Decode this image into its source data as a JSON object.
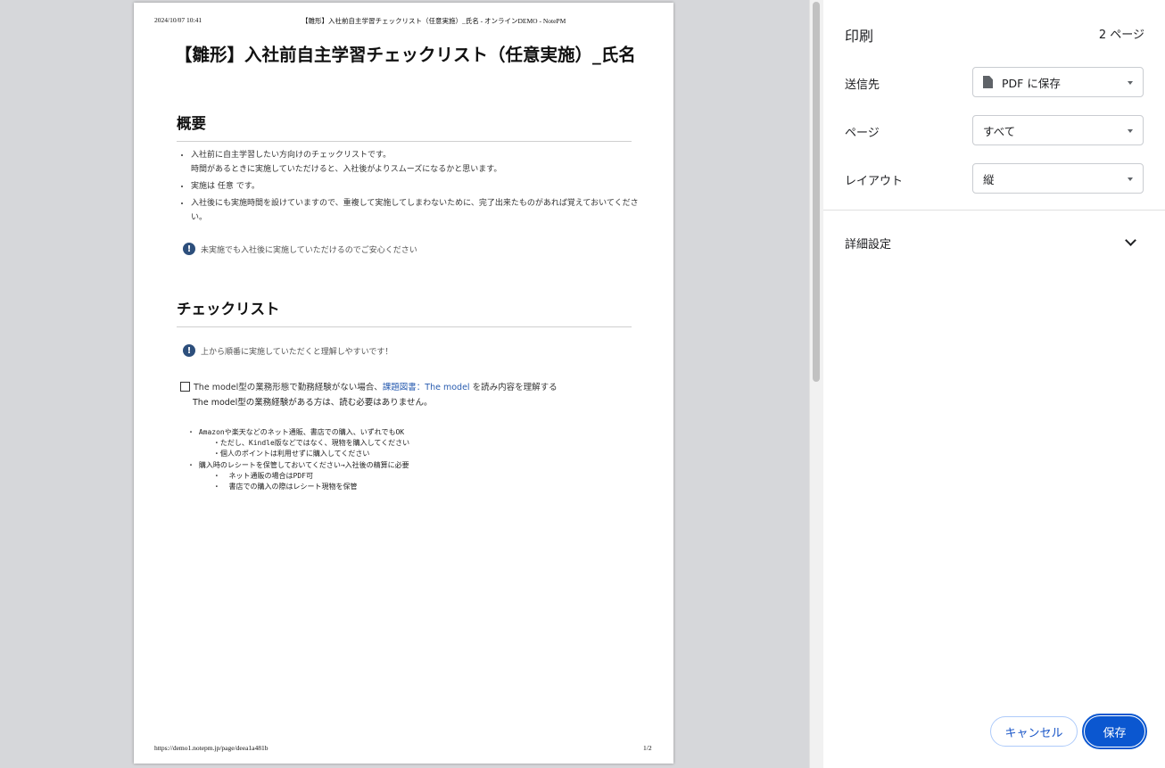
{
  "preview": {
    "header_date": "2024/10/07 10:41",
    "header_title": "【雛形】入社前自主学習チェックリスト（任意実施）_氏名 - オンラインDEMO - NotePM",
    "footer_url": "https://demo1.notepm.jp/page/deea1a481b",
    "footer_page": "1/2",
    "doc_title": "【雛形】入社前自主学習チェックリスト（任意実施）_氏名",
    "section1_heading": "概要",
    "bullets": [
      "入社前に自主学習したい方向けのチェックリストです。",
      "時間があるときに実施していただけると、入社後がよりスムーズになるかと思います。",
      "実施は 任意 です。",
      "入社後にも実施時間を設けていますので、重複して実施してしまわないために、完了出来たものがあれば覚えておいてください。"
    ],
    "note1": "未実施でも入社後に実施していただけるのでご安心ください",
    "section2_heading": "チェックリスト",
    "note2": "上から順番に実施していただくと理解しやすいです！",
    "check_item_prefix": "The model型の業務形態で勤務経験がない場合、",
    "check_item_link": "課題図書：The model",
    "check_item_suffix": " を読み内容を理解する",
    "check_item_sub": "The model型の業務経験がある方は、読む必要はありません。",
    "mono_lines": [
      "・ Amazonや楽天などのネット通販、書店での購入、いずれでもOK",
      "      ・ただし、Kindle版などではなく、現物を購入してください",
      "      ・個人のポイントは利用せずに購入してください",
      "・ 購入時のレシートを保管しておいてください→入社後の精算に必要",
      "      ・  ネット通販の場合はPDF可",
      "      ・  書店での購入の際はレシート現物を保管"
    ]
  },
  "panel": {
    "title": "印刷",
    "page_count": "2 ページ",
    "destination_label": "送信先",
    "destination_value": "PDF に保存",
    "pages_label": "ページ",
    "pages_value": "すべて",
    "layout_label": "レイアウト",
    "layout_value": "縦",
    "advanced_label": "詳細設定",
    "cancel_label": "キャンセル",
    "save_label": "保存"
  },
  "colors": {
    "accent": "#0b57d0",
    "preview_bg": "#d6d7da",
    "info_icon": "#2d4f7c"
  }
}
